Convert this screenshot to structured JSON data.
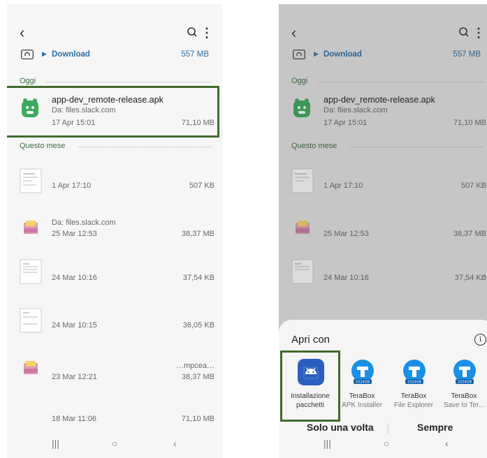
{
  "colors": {
    "accent": "#2c6ea6",
    "section": "#3d6a44",
    "highlight": "#3f6b2c",
    "android_green": "#3daa5c"
  },
  "header": {
    "back": "‹",
    "more": "⋮"
  },
  "breadcrumb": {
    "folder": "Download",
    "size": "557 MB"
  },
  "sections": {
    "today": "Oggi",
    "this_month": "Questo mese"
  },
  "left": {
    "files": [
      {
        "name": "app-dev_remote-release.apk",
        "src": "Da: files.slack.com",
        "date": "17 Apr 15:01",
        "size": "71,10 MB",
        "icon": "apk-icon"
      },
      {
        "name": "",
        "src": "",
        "date": "1 Apr 17:10",
        "size": "507 KB",
        "icon": "document-thumbnail"
      },
      {
        "name": "",
        "src": "Da: files.slack.com",
        "date": "25 Mar 12:53",
        "size": "38,37 MB",
        "icon": "archive-icon"
      },
      {
        "name": "",
        "src": "",
        "date": "24 Mar 10:16",
        "size": "37,54 KB",
        "icon": "document-thumbnail"
      },
      {
        "name": "",
        "src": "",
        "date": "24 Mar 10:15",
        "size": "36,05 KB",
        "icon": "document-thumbnail"
      },
      {
        "name": "…mpcea…",
        "src": "",
        "date": "23 Mar 12:21",
        "size": "38,37 MB",
        "icon": "archive-icon"
      },
      {
        "name": "",
        "src": "",
        "date": "18 Mar 11:06",
        "size": "71,10 MB",
        "icon": "document-thumbnail"
      }
    ]
  },
  "right": {
    "files": [
      {
        "name": "app-dev_remote-release.apk",
        "src": "Da: files.slack.com",
        "date": "17 Apr 15:01",
        "size": "71,10 MB"
      },
      {
        "date": "1 Apr 17:10",
        "size": "507 KB"
      },
      {
        "date": "25 Mar 12:53",
        "size": "38,37 MB"
      },
      {
        "date": "24 Mar 10:16",
        "size": "37,54 KB"
      }
    ],
    "sheet": {
      "title": "Apri con",
      "apps": [
        {
          "name": "Installazione",
          "sub": "pacchetti"
        },
        {
          "name": "TeraBox",
          "sub": "APK Installer"
        },
        {
          "name": "TeraBox",
          "sub": "File Explorer"
        },
        {
          "name": "TeraBox",
          "sub": "Save to Ter..."
        }
      ],
      "once": "Solo una volta",
      "always": "Sempre"
    }
  },
  "navbar": {
    "recent": "|||",
    "home": "○",
    "back": "‹"
  }
}
